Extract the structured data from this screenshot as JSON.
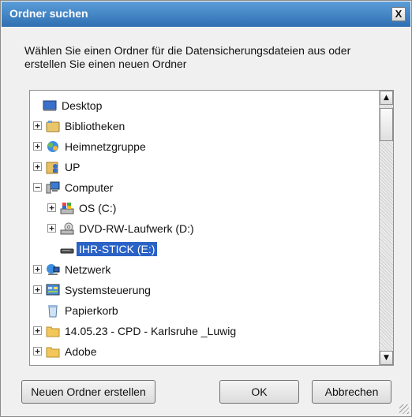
{
  "window": {
    "title": "Ordner suchen",
    "close_label": "X"
  },
  "description": "Wählen Sie einen Ordner für die Datensicherungsdateien aus oder erstellen Sie einen neuen Ordner",
  "tree": {
    "items": [
      {
        "label": "Desktop",
        "icon": "desktop-icon",
        "expander": ""
      },
      {
        "label": "Bibliotheken",
        "icon": "libraries-icon",
        "expander": "+"
      },
      {
        "label": "Heimnetzgruppe",
        "icon": "homegroup-icon",
        "expander": "+"
      },
      {
        "label": "UP",
        "icon": "user-folder-icon",
        "expander": "+"
      },
      {
        "label": "Computer",
        "icon": "computer-icon",
        "expander": "−"
      },
      {
        "label": "OS (C:)",
        "icon": "system-drive-icon",
        "expander": "+"
      },
      {
        "label": "DVD-RW-Laufwerk (D:)",
        "icon": "dvd-drive-icon",
        "expander": "+"
      },
      {
        "label": "IHR-STICK (E:)",
        "icon": "usb-drive-icon",
        "expander": ""
      },
      {
        "label": "Netzwerk",
        "icon": "network-icon",
        "expander": "+"
      },
      {
        "label": "Systemsteuerung",
        "icon": "control-panel-icon",
        "expander": "+"
      },
      {
        "label": "Papierkorb",
        "icon": "recycle-bin-icon",
        "expander": ""
      },
      {
        "label": "14.05.23 - CPD - Karlsruhe _Luwig",
        "icon": "folder-icon",
        "expander": "+"
      },
      {
        "label": "Adobe",
        "icon": "folder-icon",
        "expander": "+"
      }
    ]
  },
  "scrollbar": {
    "up": "▲",
    "down": "▼"
  },
  "buttons": {
    "new_folder": "Neuen Ordner erstellen",
    "ok": "OK",
    "cancel": "Abbrechen"
  },
  "colors": {
    "selection": "#2a62c6",
    "titlebar": "#2f6fb2"
  }
}
